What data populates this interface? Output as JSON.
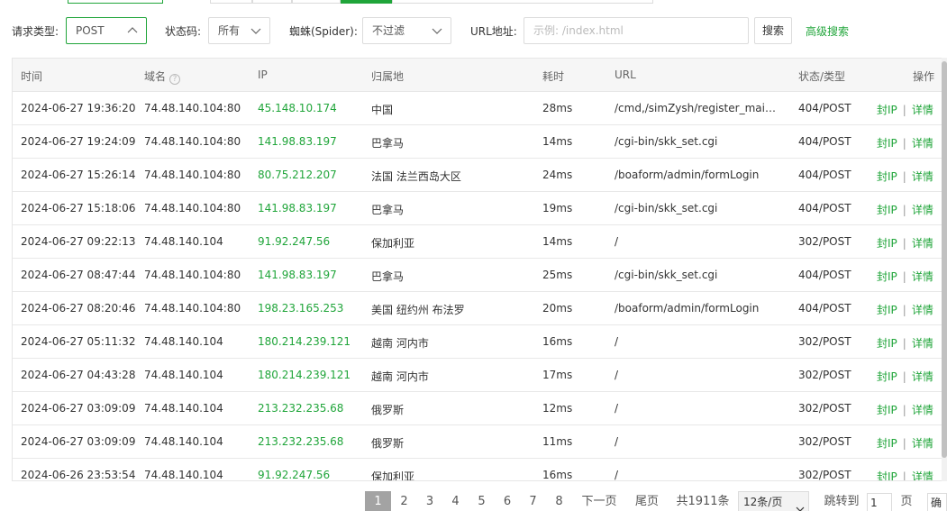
{
  "filters": {
    "request_type_label": "请求类型:",
    "request_type_value": "POST",
    "status_label": "状态码:",
    "status_value": "所有",
    "spider_label": "蜘蛛(Spider):",
    "spider_value": "不过滤",
    "url_label": "URL地址:",
    "url_placeholder": "示例: /index.html",
    "search_label": "搜索",
    "advanced_label": "高级搜索"
  },
  "table": {
    "headers": {
      "time": "时间",
      "domain": "域名",
      "ip": "IP",
      "location": "归属地",
      "duration": "耗时",
      "url": "URL",
      "status": "状态/类型",
      "actions": "操作"
    },
    "action_block": "封IP",
    "action_sep": "|",
    "action_detail": "详情",
    "rows": [
      {
        "time": "2024-06-27 19:36:20",
        "domain": "74.48.140.104:80",
        "ip": "45.148.10.174",
        "location": "中国",
        "duration": "28ms",
        "url": "/cmd,/simZysh/register_main/setCookie",
        "status": "404/POST"
      },
      {
        "time": "2024-06-27 19:24:09",
        "domain": "74.48.140.104:80",
        "ip": "141.98.83.197",
        "location": "巴拿马",
        "duration": "14ms",
        "url": "/cgi-bin/skk_set.cgi",
        "status": "404/POST"
      },
      {
        "time": "2024-06-27 15:26:14",
        "domain": "74.48.140.104:80",
        "ip": "80.75.212.207",
        "location": "法国 法兰西岛大区",
        "duration": "24ms",
        "url": "/boaform/admin/formLogin",
        "status": "404/POST"
      },
      {
        "time": "2024-06-27 15:18:06",
        "domain": "74.48.140.104:80",
        "ip": "141.98.83.197",
        "location": "巴拿马",
        "duration": "19ms",
        "url": "/cgi-bin/skk_set.cgi",
        "status": "404/POST"
      },
      {
        "time": "2024-06-27 09:22:13",
        "domain": "74.48.140.104",
        "ip": "91.92.247.56",
        "location": "保加利亚",
        "duration": "14ms",
        "url": "/",
        "status": "302/POST"
      },
      {
        "time": "2024-06-27 08:47:44",
        "domain": "74.48.140.104:80",
        "ip": "141.98.83.197",
        "location": "巴拿马",
        "duration": "25ms",
        "url": "/cgi-bin/skk_set.cgi",
        "status": "404/POST"
      },
      {
        "time": "2024-06-27 08:20:46",
        "domain": "74.48.140.104:80",
        "ip": "198.23.165.253",
        "location": "美国 纽约州 布法罗",
        "duration": "20ms",
        "url": "/boaform/admin/formLogin",
        "status": "404/POST"
      },
      {
        "time": "2024-06-27 05:11:32",
        "domain": "74.48.140.104",
        "ip": "180.214.239.121",
        "location": "越南 河内市",
        "duration": "16ms",
        "url": "/",
        "status": "302/POST"
      },
      {
        "time": "2024-06-27 04:43:28",
        "domain": "74.48.140.104",
        "ip": "180.214.239.121",
        "location": "越南 河内市",
        "duration": "17ms",
        "url": "/",
        "status": "302/POST"
      },
      {
        "time": "2024-06-27 03:09:09",
        "domain": "74.48.140.104",
        "ip": "213.232.235.68",
        "location": "俄罗斯",
        "duration": "12ms",
        "url": "/",
        "status": "302/POST"
      },
      {
        "time": "2024-06-27 03:09:09",
        "domain": "74.48.140.104",
        "ip": "213.232.235.68",
        "location": "俄罗斯",
        "duration": "11ms",
        "url": "/",
        "status": "302/POST"
      },
      {
        "time": "2024-06-26 23:53:54",
        "domain": "74.48.140.104",
        "ip": "91.92.247.56",
        "location": "保加利亚",
        "duration": "16ms",
        "url": "/",
        "status": "302/POST"
      }
    ]
  },
  "pagination": {
    "pages": [
      "1",
      "2",
      "3",
      "4",
      "5",
      "6",
      "7",
      "8"
    ],
    "current": "1",
    "next_label": "下一页",
    "last_label": "尾页",
    "total_label": "共1911条",
    "page_size_label": "12条/页",
    "jump_label": "跳转到",
    "jump_value": "1",
    "page_unit": "页",
    "confirm_label": "确认"
  },
  "colors": {
    "accent": "#20a53a",
    "current_page_bg": "#a3a3a3"
  }
}
